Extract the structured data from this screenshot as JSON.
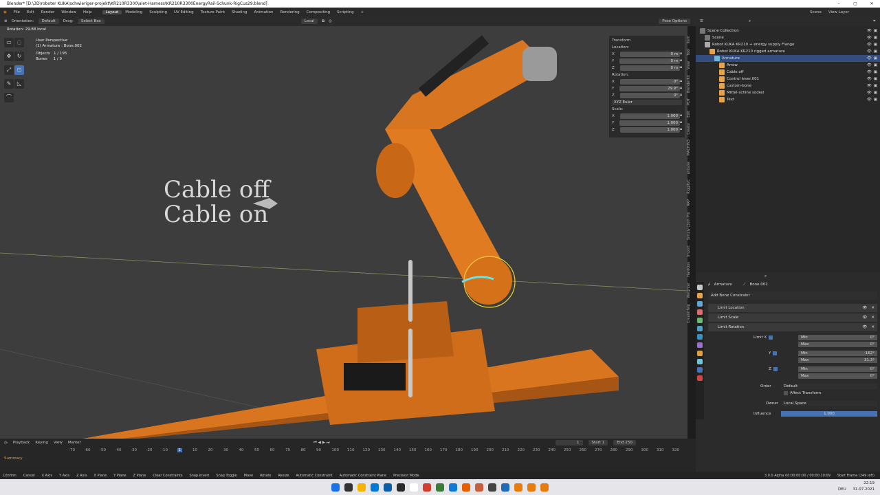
{
  "title_bar": {
    "text": "Blender* [D:\\3D\\roboter KUKA\\schwieriger-projekt\\KR210R3300\\alet-Harness\\KR210R3300EnergyRail-Schunk-RigCus29.blend]",
    "controls": [
      "–",
      "▢",
      "✕"
    ]
  },
  "menu": {
    "items": [
      "File",
      "Edit",
      "Render",
      "Window",
      "Help"
    ],
    "workspaces": [
      "Layout",
      "Modeling",
      "Sculpting",
      "UV Editing",
      "Texture Paint",
      "Shading",
      "Animation",
      "Rendering",
      "Compositing",
      "Scripting"
    ],
    "active_workspace": "Layout"
  },
  "viewport_header": {
    "orientation_label": "Orientation:",
    "orientation_value": "Default",
    "drag_label": "Drag:",
    "drag_value": "Select Box",
    "pivot": "Local",
    "pose_options": "Pose Options"
  },
  "operator_status": "Rotation: 29.88 local",
  "viewport_info": {
    "view": "User Perspective",
    "active": "(1) Armature : Bone.002",
    "objects_label": "Objects",
    "objects_value": "1 / 195",
    "bones_label": "Bones",
    "bones_value": "1 / 9"
  },
  "overlay_text": {
    "line1": "Cable off",
    "line2": "Cable on"
  },
  "transform": {
    "title": "Transform",
    "location_label": "Location:",
    "location": [
      {
        "axis": "X",
        "value": "0 m"
      },
      {
        "axis": "Y",
        "value": "0 m"
      },
      {
        "axis": "Z",
        "value": "0 m"
      }
    ],
    "rotation_label": "Rotation:",
    "rotation": [
      {
        "axis": "X",
        "value": "0°"
      },
      {
        "axis": "Y",
        "value": "29.9°"
      },
      {
        "axis": "Z",
        "value": "0°"
      }
    ],
    "rot_mode": "XYZ Euler",
    "scale_label": "Scale:",
    "scale": [
      {
        "axis": "X",
        "value": "1.000"
      },
      {
        "axis": "Y",
        "value": "1.000"
      },
      {
        "axis": "Z",
        "value": "1.000"
      }
    ]
  },
  "sidebar_tabs": [
    "Item",
    "Tool",
    "View",
    "BlenderKit",
    "PDT",
    "Edit",
    "Create",
    "MACHIN3",
    "unbake",
    "RiggifyC",
    "ARP",
    "Simply Cloth Pro",
    "Import",
    "HardOps",
    "Weighter",
    "CreateHelp"
  ],
  "outliner": {
    "header_scene": "Scene",
    "header_layer": "View Layer",
    "rows": [
      {
        "label": "Scene Collection",
        "indent": 0,
        "color": "#777777",
        "selected": false
      },
      {
        "label": "Scene",
        "indent": 1,
        "color": "#777777",
        "selected": false
      },
      {
        "label": "Robot KUKA KR210 + energy supply Flange",
        "indent": 1,
        "color": "#aaaaaa",
        "selected": false
      },
      {
        "label": "Robot KUKA KR210 rigged armature",
        "indent": 2,
        "color": "#e8a24a",
        "selected": false
      },
      {
        "label": "Armature",
        "indent": 3,
        "color": "#6fb6d6",
        "selected": true
      },
      {
        "label": "Arrow",
        "indent": 4,
        "color": "#e8a24a",
        "selected": false
      },
      {
        "label": "Cable off",
        "indent": 4,
        "color": "#e8a24a",
        "selected": false
      },
      {
        "label": "Control lever.001",
        "indent": 4,
        "color": "#e8a24a",
        "selected": false
      },
      {
        "label": "custom-bone",
        "indent": 4,
        "color": "#e8a24a",
        "selected": false
      },
      {
        "label": "Mittel-schine sockel",
        "indent": 4,
        "color": "#e8a24a",
        "selected": false
      },
      {
        "label": "Text",
        "indent": 4,
        "color": "#e8a24a",
        "selected": false
      }
    ]
  },
  "properties": {
    "object": "Armature",
    "bone": "Bone.002",
    "add_constraint": "Add Bone Constraint",
    "constraints": [
      "Limit Location",
      "Limit Scale",
      "Limit Rotation"
    ],
    "limit_x_label": "Limit X",
    "y_label": "Y",
    "z_label": "Z",
    "min_label": "Min",
    "max_label": "Max",
    "x_min": "0°",
    "x_max": "0°",
    "y_min": "-162°",
    "y_max": "31.3°",
    "z_min": "0°",
    "z_max": "0°",
    "order_label": "Order",
    "order_value": "Default",
    "affect_transform": "Affect Transform",
    "owner_label": "Owner",
    "owner_value": "Local Space",
    "influence_label": "Influence",
    "influence_value": "1.000",
    "influence_fraction": 1.0
  },
  "timeline": {
    "menus": [
      "Playback",
      "Keying",
      "View",
      "Marker"
    ],
    "current_frame": "1",
    "start_label": "Start",
    "start": "1",
    "end_label": "End",
    "end": "250",
    "summary": "Summary",
    "ticks": [
      "-70",
      "-60",
      "-50",
      "-40",
      "-30",
      "-20",
      "-10",
      "1",
      "10",
      "20",
      "30",
      "40",
      "50",
      "60",
      "70",
      "80",
      "90",
      "100",
      "110",
      "120",
      "130",
      "140",
      "150",
      "160",
      "170",
      "180",
      "190",
      "200",
      "210",
      "220",
      "230",
      "240",
      "250",
      "260",
      "270",
      "280",
      "290",
      "300",
      "310",
      "320"
    ]
  },
  "status_bar": {
    "items": [
      "Confirm",
      "Cancel",
      "X Axis",
      "Y Axis",
      "Z Axis",
      "X Plane",
      "Y Plane",
      "Z Plane",
      "Clear Constraints",
      "Snap Invert",
      "Snap Toggle",
      "Move",
      "Rotate",
      "Resize",
      "Automatic Constraint",
      "Automatic Constraint Plane",
      "Precision Mode"
    ],
    "version": "3.0.0 Alpha 00:00:00:00 / 00:00:10:09",
    "frames": "Start Frame (249 left)"
  },
  "taskbar": {
    "time": "22:19",
    "date": "31.07.2021",
    "lang": "DEU",
    "icon_colors": [
      "#1a73e8",
      "#333333",
      "#f4b400",
      "#0078d4",
      "#0b5ea8",
      "#2b2b2b",
      "#ffffff",
      "#d23f31",
      "#3a7b3a",
      "#0f7bd6",
      "#e66000",
      "#c85f3b",
      "#444444",
      "#1e6bb8",
      "#e87d0d",
      "#e87d0d",
      "#e87d0d"
    ]
  }
}
